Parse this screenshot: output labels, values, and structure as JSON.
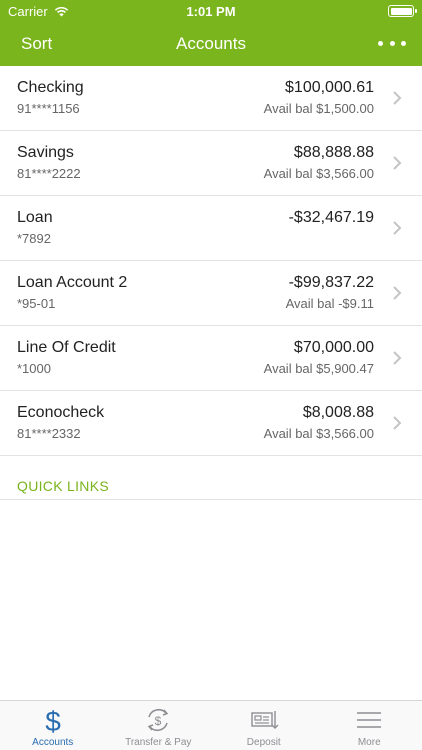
{
  "status_bar": {
    "carrier": "Carrier",
    "time": "1:01 PM"
  },
  "nav": {
    "left_label": "Sort",
    "title": "Accounts"
  },
  "accounts": [
    {
      "name": "Checking",
      "number": "91****1156",
      "balance": "$100,000.61",
      "avail": "Avail bal $1,500.00"
    },
    {
      "name": "Savings",
      "number": "81****2222",
      "balance": "$88,888.88",
      "avail": "Avail bal $3,566.00"
    },
    {
      "name": "Loan",
      "number": "*7892",
      "balance": "-$32,467.19",
      "avail": ""
    },
    {
      "name": "Loan Account 2",
      "number": "*95-01",
      "balance": "-$99,837.22",
      "avail": "Avail bal -$9.11"
    },
    {
      "name": "Line Of Credit",
      "number": "*1000",
      "balance": "$70,000.00",
      "avail": "Avail bal $5,900.47"
    },
    {
      "name": "Econocheck",
      "number": "81****2332",
      "balance": "$8,008.88",
      "avail": "Avail bal $3,566.00"
    }
  ],
  "quick_links": {
    "label": "QUICK LINKS"
  },
  "tabbar": {
    "tabs": [
      {
        "label": "Accounts",
        "icon": "dollar-icon",
        "active": true
      },
      {
        "label": "Transfer & Pay",
        "icon": "transfer-pay-icon",
        "active": false
      },
      {
        "label": "Deposit",
        "icon": "check-deposit-icon",
        "active": false
      },
      {
        "label": "More",
        "icon": "menu-icon",
        "active": false
      }
    ]
  },
  "colors": {
    "brand_green": "#7ab51d",
    "active_tab_blue": "#2a6db0",
    "inactive_tab_gray": "#8e8e93"
  }
}
